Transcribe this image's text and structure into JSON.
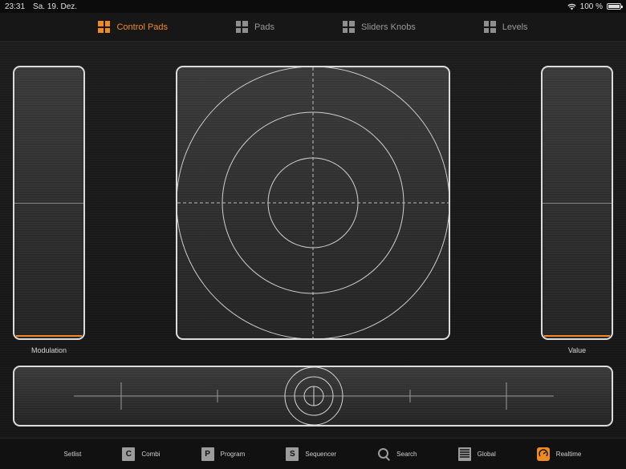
{
  "status": {
    "time": "23:31",
    "date": "Sa. 19. Dez.",
    "battery": "100 %"
  },
  "topnav": {
    "tabs": [
      {
        "label": "Control Pads",
        "active": true,
        "icon": "grid-icon"
      },
      {
        "label": "Pads",
        "active": false,
        "icon": "grid-icon"
      },
      {
        "label": "Sliders Knobs",
        "active": false,
        "icon": "grid-icon"
      },
      {
        "label": "Levels",
        "active": false,
        "icon": "grid-icon"
      }
    ]
  },
  "controls": {
    "left_slider_label": "Modulation",
    "right_slider_label": "Value",
    "left_slider_level": 0.0,
    "right_slider_level": 0.0
  },
  "bottombar": {
    "items": [
      {
        "label": "Setlist",
        "icon": "grid-icon"
      },
      {
        "label": "Combi",
        "icon": "combi-icon",
        "glyph": "C"
      },
      {
        "label": "Program",
        "icon": "program-icon",
        "glyph": "P"
      },
      {
        "label": "Sequencer",
        "icon": "sequencer-icon",
        "glyph": "S"
      },
      {
        "label": "Search",
        "icon": "search-icon"
      },
      {
        "label": "Global",
        "icon": "global-icon"
      },
      {
        "label": "Realtime",
        "icon": "realtime-icon",
        "active": true
      }
    ]
  },
  "colors": {
    "accent": "#f08a24",
    "panel_border": "#dcdcdc"
  }
}
